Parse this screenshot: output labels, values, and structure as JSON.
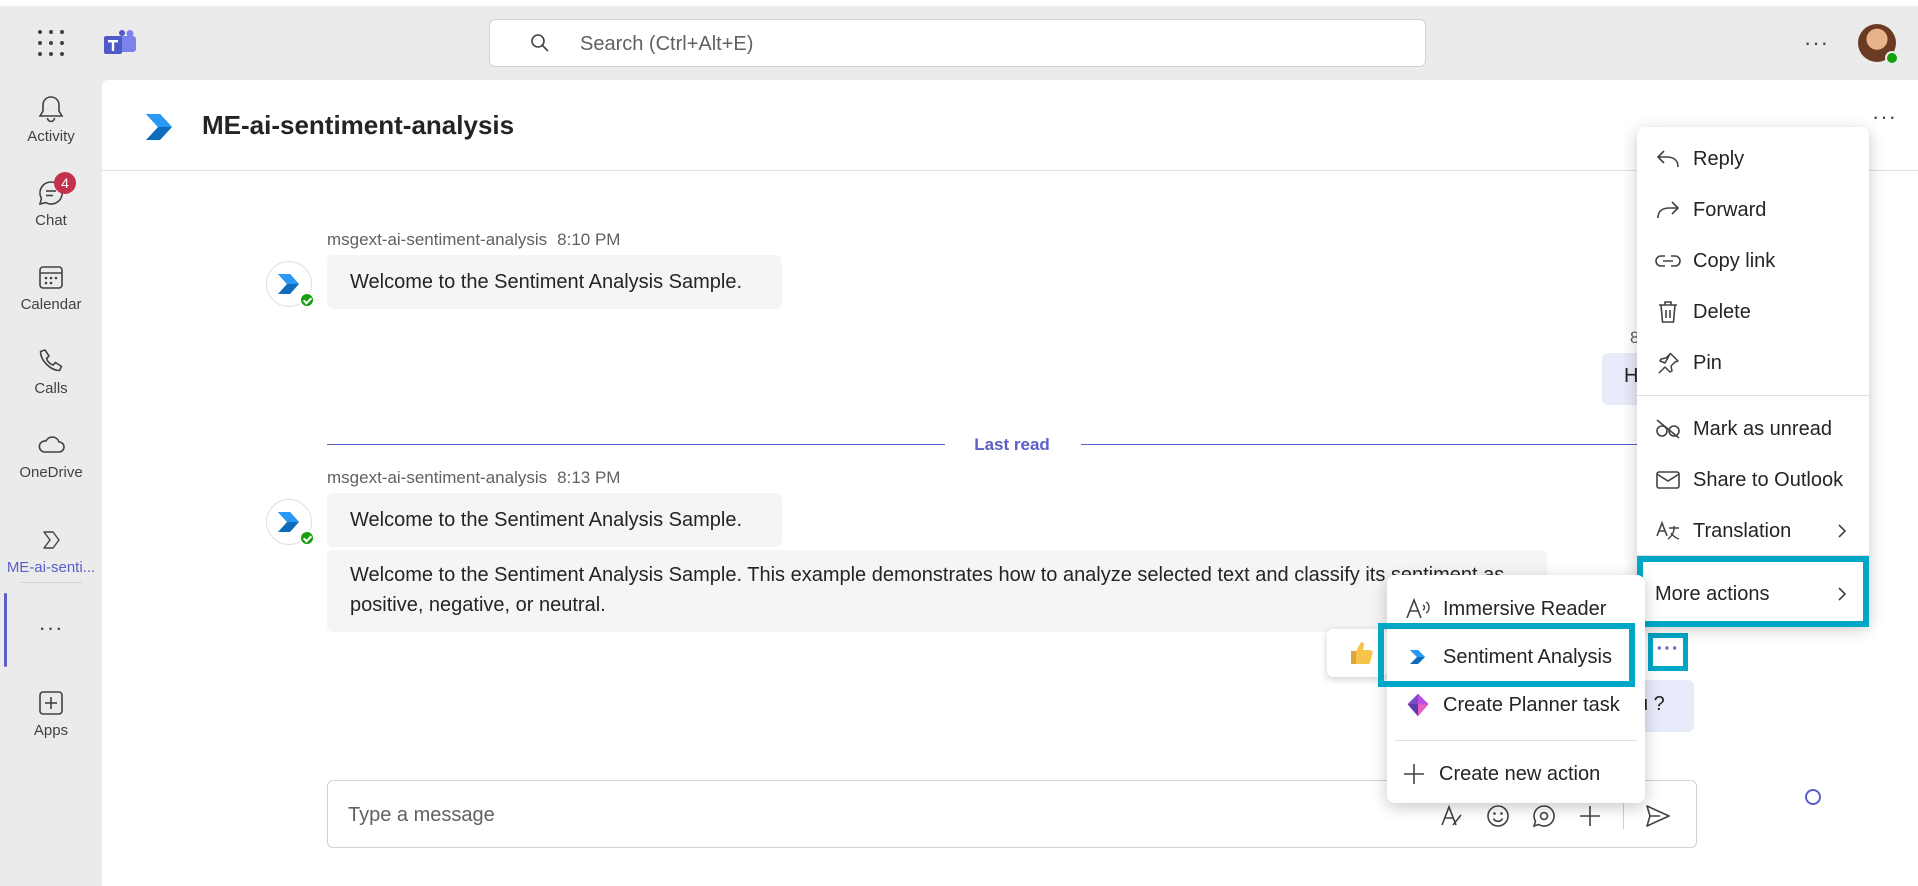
{
  "topbar": {
    "search_placeholder": "Search (Ctrl+Alt+E)",
    "more_label": "···"
  },
  "rail": {
    "items": [
      {
        "label": "Activity",
        "icon": "bell-icon"
      },
      {
        "label": "Chat",
        "icon": "chat-icon",
        "badge": "4"
      },
      {
        "label": "Calendar",
        "icon": "calendar-icon"
      },
      {
        "label": "Calls",
        "icon": "phone-icon"
      },
      {
        "label": "OneDrive",
        "icon": "cloud-icon"
      },
      {
        "label": "ME-ai-senti...",
        "icon": "app-icon"
      },
      {
        "label": "···",
        "icon": "more-icon"
      },
      {
        "label": "Apps",
        "icon": "apps-add-icon"
      }
    ]
  },
  "chat": {
    "title": "ME-ai-sentiment-analysis",
    "messages": [
      {
        "sender": "msgext-ai-sentiment-analysis",
        "time": "8:10 PM",
        "text": "Welcome to the Sentiment Analysis Sample."
      },
      {
        "sender": "msgext-ai-sentiment-analysis",
        "time": "8:13 PM",
        "text": "Welcome to the Sentiment Analysis Sample."
      },
      {
        "text": "Welcome to the Sentiment Analysis Sample. This example demonstrates how to analyze selected text and classify its sentiment as positive, negative, or neutral."
      }
    ],
    "my_messages": [
      {
        "time": "8",
        "text": "H"
      },
      {
        "text": "u ?"
      }
    ],
    "last_read_label": "Last read",
    "composer_placeholder": "Type a message"
  },
  "context_menu": {
    "items": [
      "Reply",
      "Forward",
      "Copy link",
      "Delete",
      "Pin",
      "Mark as unread",
      "Share to Outlook",
      "Translation",
      "More actions"
    ]
  },
  "submenu": {
    "items": [
      "Immersive Reader",
      "Sentiment Analysis",
      "Create Planner task",
      "Create new action"
    ]
  },
  "colors": {
    "accent": "#5b5fc7",
    "highlight": "#00a7c6",
    "badge": "#c4314b",
    "online": "#13a10e"
  }
}
